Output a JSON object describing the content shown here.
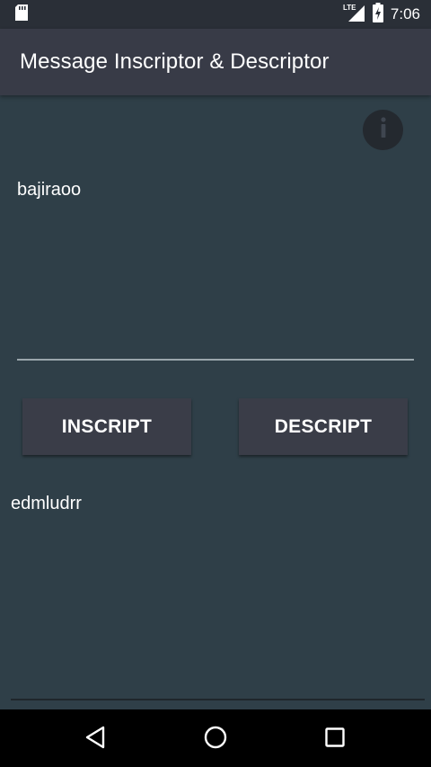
{
  "status_bar": {
    "time": "7:06",
    "network": "LTE",
    "icons": [
      "sd-card-icon",
      "lte-signal-icon",
      "battery-charging-icon"
    ]
  },
  "app_bar": {
    "title": "Message Inscriptor & Descriptor"
  },
  "main": {
    "info_icon": "info-icon",
    "input_value": "bajiraoo",
    "inscript_label": "INSCRIPT",
    "descript_label": "DESCRIPT",
    "output_value": "edmludrr"
  },
  "nav_bar": {
    "icons": [
      "back-icon",
      "home-icon",
      "recents-icon"
    ]
  },
  "colors": {
    "background": "#2f3f48",
    "app_bar": "#383b47",
    "status_bar": "#2a2f37",
    "button": "#3a3d48",
    "nav_bar": "#000000"
  }
}
